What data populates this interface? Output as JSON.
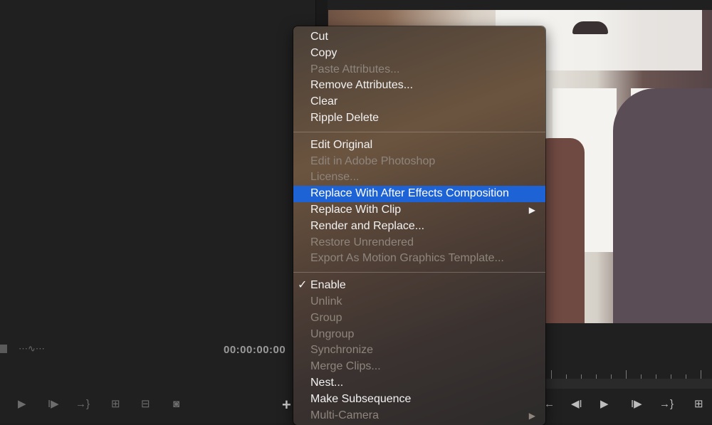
{
  "program_monitor": {
    "timecode": "00:00:00:00"
  },
  "source_controls": [
    {
      "name": "play-icon",
      "glyph": "▶"
    },
    {
      "name": "step-forward-icon",
      "glyph": "I▶"
    },
    {
      "name": "go-to-out-icon",
      "glyph": "→}"
    },
    {
      "name": "insert-icon",
      "glyph": "⊞"
    },
    {
      "name": "overwrite-icon",
      "glyph": "⊟"
    },
    {
      "name": "camera-icon",
      "glyph": "◙"
    }
  ],
  "add_button": "+",
  "program_controls": [
    {
      "name": "go-to-in-icon",
      "glyph": "←"
    },
    {
      "name": "step-back-icon",
      "glyph": "◀I"
    },
    {
      "name": "play-icon",
      "glyph": "▶"
    },
    {
      "name": "step-forward-icon",
      "glyph": "I▶"
    },
    {
      "name": "go-to-out-icon",
      "glyph": "→}"
    },
    {
      "name": "lift-icon",
      "glyph": "⊞"
    }
  ],
  "context_menu": {
    "groups": [
      [
        {
          "label": "Cut",
          "enabled": true
        },
        {
          "label": "Copy",
          "enabled": true
        },
        {
          "label": "Paste Attributes...",
          "enabled": false
        },
        {
          "label": "Remove Attributes...",
          "enabled": true
        },
        {
          "label": "Clear",
          "enabled": true
        },
        {
          "label": "Ripple Delete",
          "enabled": true
        }
      ],
      [
        {
          "label": "Edit Original",
          "enabled": true
        },
        {
          "label": "Edit in Adobe Photoshop",
          "enabled": false
        },
        {
          "label": "License...",
          "enabled": false
        },
        {
          "label": "Replace With After Effects Composition",
          "enabled": true,
          "highlighted": true
        },
        {
          "label": "Replace With Clip",
          "enabled": true,
          "submenu": true
        },
        {
          "label": "Render and Replace...",
          "enabled": true
        },
        {
          "label": "Restore Unrendered",
          "enabled": false
        },
        {
          "label": "Export As Motion Graphics Template...",
          "enabled": false
        }
      ],
      [
        {
          "label": "Enable",
          "enabled": true,
          "checked": true
        },
        {
          "label": "Unlink",
          "enabled": false
        },
        {
          "label": "Group",
          "enabled": false
        },
        {
          "label": "Ungroup",
          "enabled": false
        },
        {
          "label": "Synchronize",
          "enabled": false
        },
        {
          "label": "Merge Clips...",
          "enabled": false
        },
        {
          "label": "Nest...",
          "enabled": true
        },
        {
          "label": "Make Subsequence",
          "enabled": true
        },
        {
          "label": "Multi-Camera",
          "enabled": false,
          "submenu": true
        }
      ]
    ],
    "check_glyph": "✓",
    "submenu_glyph": "▶",
    "highlight_color": "#1d63d6"
  }
}
